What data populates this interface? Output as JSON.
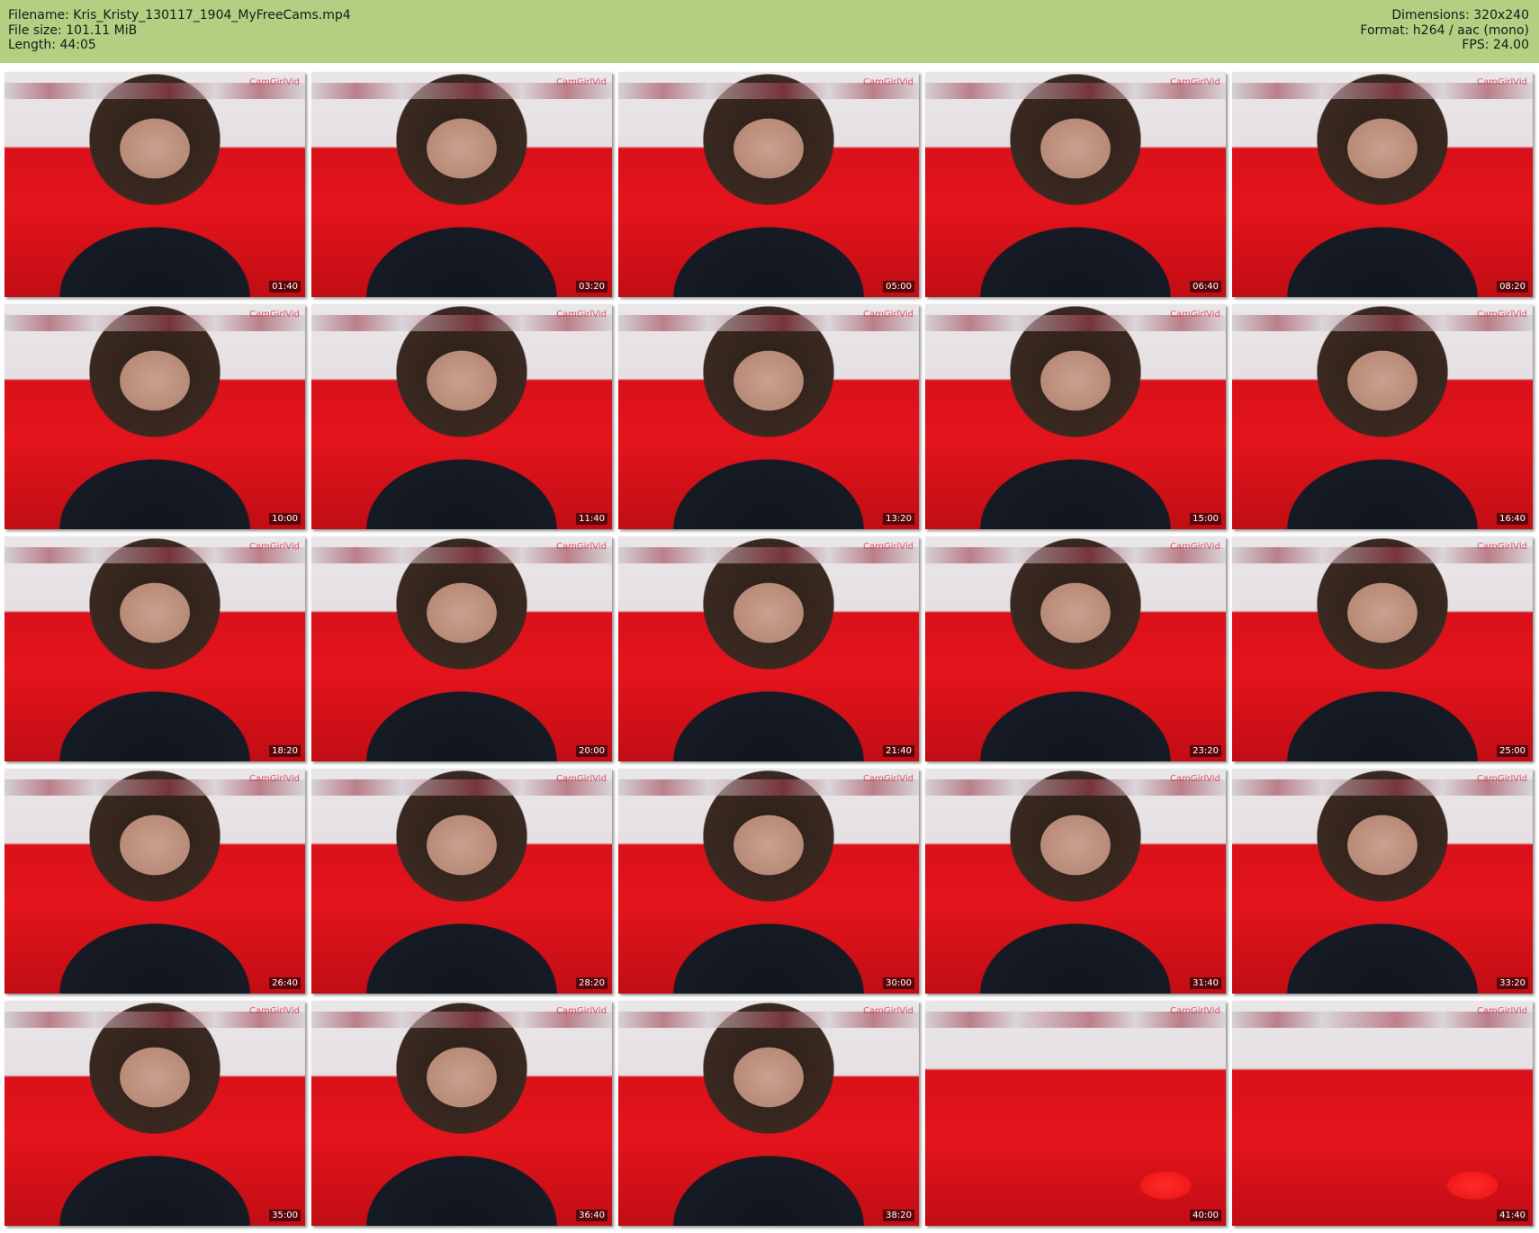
{
  "header": {
    "filename": "Filename: Kris_Kristy_130117_1904_MyFreeCams.mp4",
    "filesize": "File size: 101.11 MiB",
    "length": "Length: 44:05",
    "dimensions": "Dimensions: 320x240",
    "format": "Format: h264 / aac (mono)",
    "fps": "FPS: 24.00"
  },
  "watermark": "CamGirlVid",
  "thumbnails": [
    "01:40",
    "03:20",
    "05:00",
    "06:40",
    "08:20",
    "10:00",
    "11:40",
    "13:20",
    "15:00",
    "16:40",
    "18:20",
    "20:00",
    "21:40",
    "23:20",
    "25:00",
    "26:40",
    "28:20",
    "30:00",
    "31:40",
    "33:20",
    "35:00",
    "36:40",
    "38:20",
    "40:00",
    "41:40"
  ],
  "colors": {
    "header_bg": "#b2cf82",
    "sofa_red": "#e4141c"
  }
}
